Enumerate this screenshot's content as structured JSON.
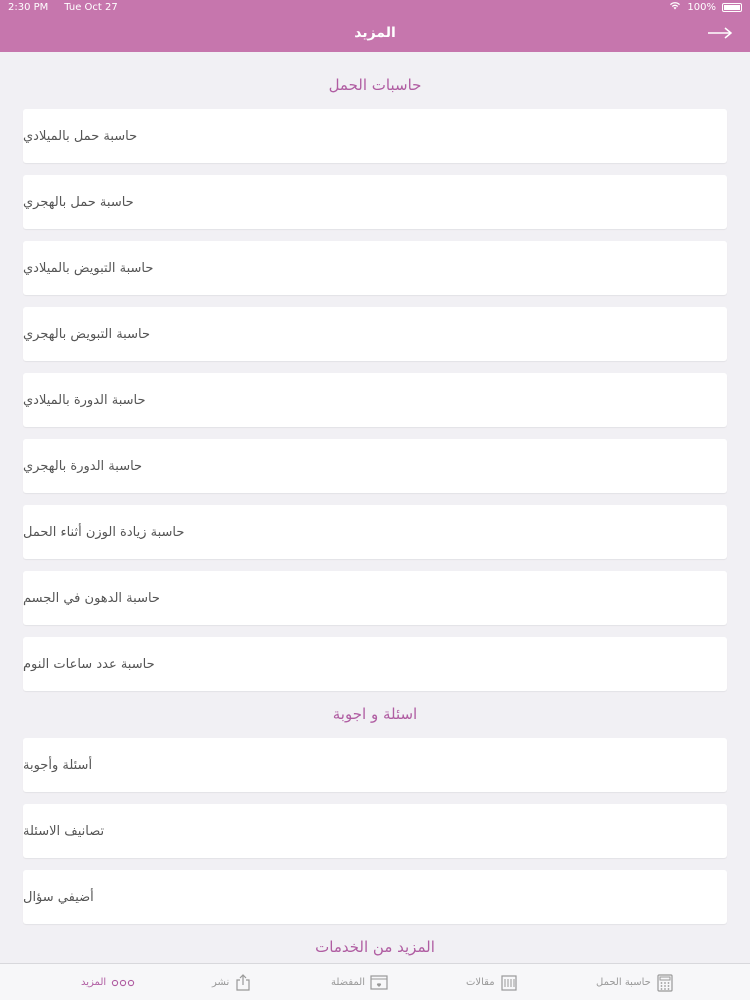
{
  "status_bar": {
    "time": "2:30 PM",
    "date": "Tue Oct 27",
    "battery": "100%"
  },
  "nav": {
    "title": "المزيد"
  },
  "sections": {
    "pregnancy_calculators": {
      "title": "حاسبات الحمل",
      "items": [
        "حاسبة حمل بالميلادي",
        "حاسبة حمل بالهجري",
        "حاسبة التبويض بالميلادي",
        "حاسبة التبويض بالهجري",
        "حاسبة الدورة بالميلادي",
        "حاسبة الدورة بالهجري",
        "حاسبة زيادة الوزن أثناء الحمل",
        "حاسبة الدهون في الجسم",
        "حاسبة عدد ساعات النوم"
      ]
    },
    "qa": {
      "title": "اسئلة و اجوبة",
      "items": [
        "أسئلة وأجوبة",
        "تصانيف الاسئلة",
        "أضيفي سؤال"
      ]
    },
    "more_services": {
      "title": "المزيد من الخدمات"
    }
  },
  "tab_bar": {
    "tabs": [
      {
        "label": "حاسبة الحمل",
        "icon": "calculator-icon"
      },
      {
        "label": "مقالات",
        "icon": "articles-icon"
      },
      {
        "label": "المفضلة",
        "icon": "favorites-icon"
      },
      {
        "label": "نشر",
        "icon": "share-icon"
      },
      {
        "label": "المزيد",
        "icon": "more-icon"
      }
    ],
    "active_index": 4
  },
  "colors": {
    "accent": "#c676ad",
    "section_title": "#b05da2",
    "background": "#f1f0f4"
  }
}
